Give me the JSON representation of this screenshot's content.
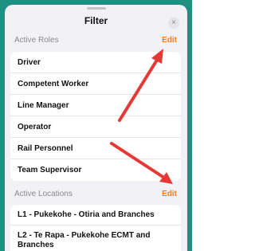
{
  "sheet": {
    "title": "Filter",
    "close_glyph": "×"
  },
  "roles": {
    "header": "Active Roles",
    "edit_label": "Edit",
    "items": [
      {
        "label": "Driver"
      },
      {
        "label": "Competent Worker"
      },
      {
        "label": "Line Manager"
      },
      {
        "label": "Operator"
      },
      {
        "label": "Rail Personnel"
      },
      {
        "label": "Team Supervisor"
      }
    ]
  },
  "locations": {
    "header": "Active Locations",
    "edit_label": "Edit",
    "items": [
      {
        "label": "L1 - Pukekohe - Otiria and Branches"
      },
      {
        "label": "L2 - Te Rapa - Pukekohe ECMT and Branches"
      }
    ]
  },
  "colors": {
    "accent": "#f47b20",
    "annotation_arrow": "#e53935",
    "background_frame": "#1f8f82"
  }
}
